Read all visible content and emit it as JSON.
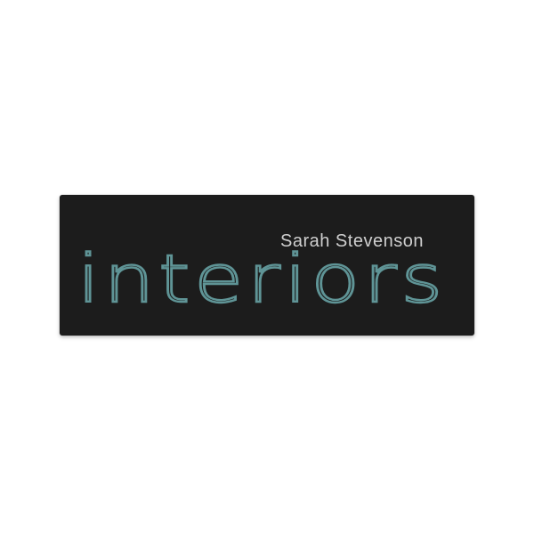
{
  "badge": {
    "name": "Sarah Stevenson",
    "wordmark": "interiors",
    "colors": {
      "background": "#1c1c1c",
      "name_text": "#cfcfcf",
      "wordmark": "#5f9496"
    }
  }
}
